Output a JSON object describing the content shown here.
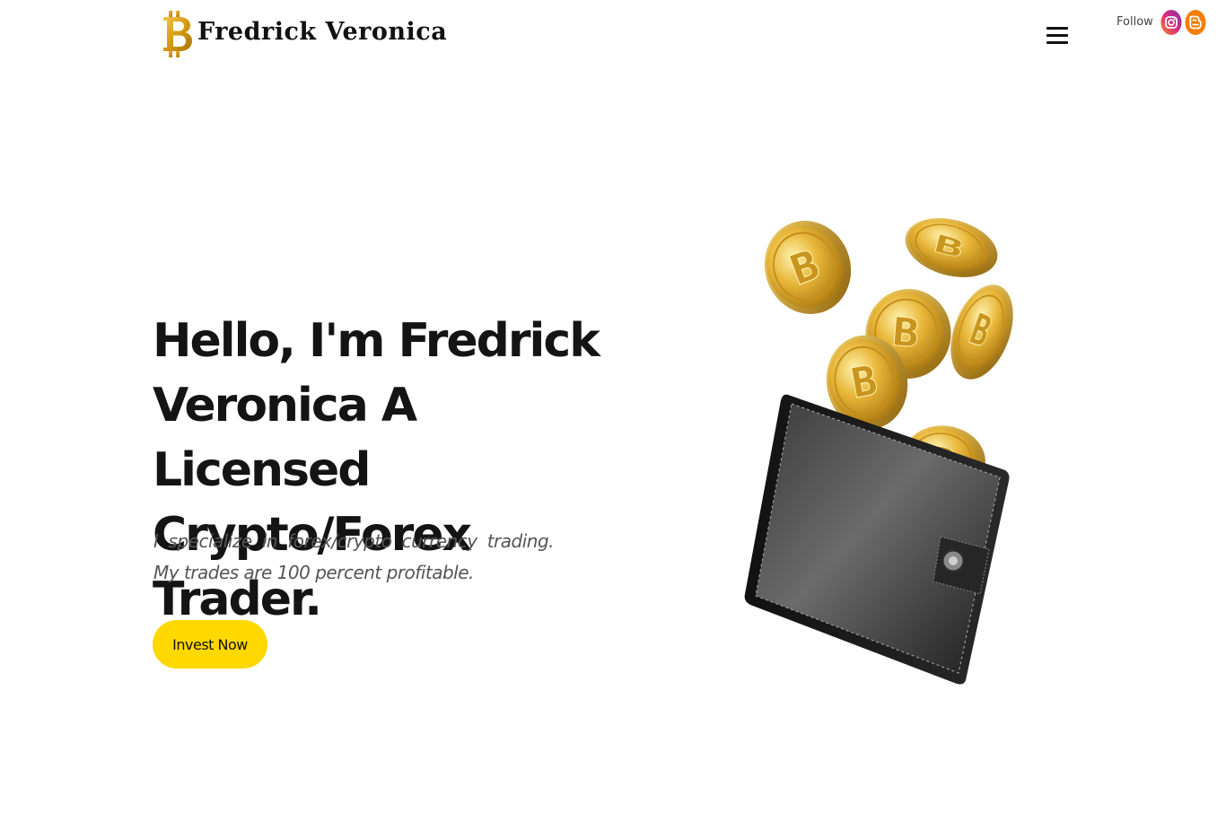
{
  "header": {
    "brand_name": "Fredrick Veronica",
    "logo_icon": "bitcoin-b-icon",
    "menu_icon": "hamburger-menu-icon",
    "follow_label": "Follow",
    "social": [
      {
        "name": "instagram",
        "icon": "instagram-icon",
        "color": "#e1306c"
      },
      {
        "name": "blogger",
        "icon": "blogger-icon",
        "color": "#f57d00"
      }
    ]
  },
  "hero": {
    "title": "Hello, I'm Fredrick Veronica A Licensed Crypto/Forex Trader.",
    "subtitle": "I specialize in forex/crypto currency trading. My trades are 100 percent profitable.",
    "cta_label": "Invest Now",
    "illustration": "bitcoin-coins-falling-into-wallet"
  },
  "colors": {
    "accent": "#ffd800",
    "gold": "#d4a017",
    "text": "#141414",
    "muted": "#555555",
    "background": "#ffffff"
  }
}
